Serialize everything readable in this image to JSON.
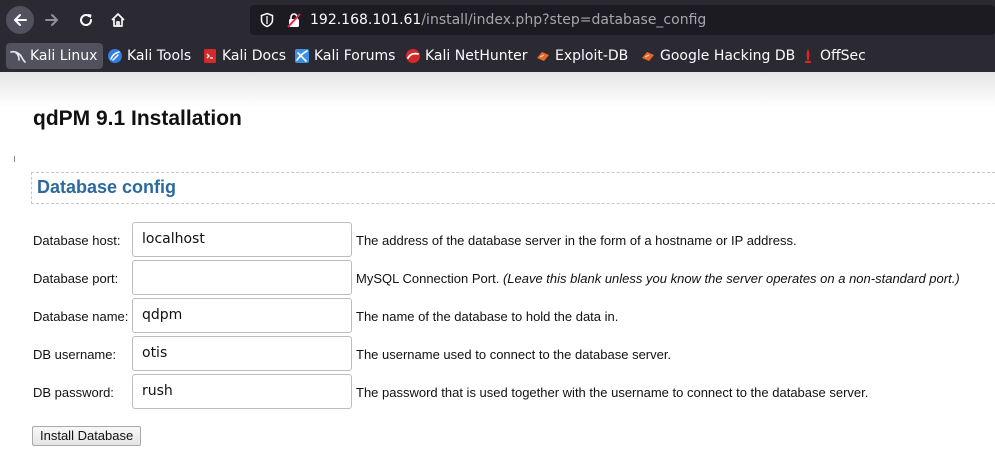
{
  "browser": {
    "url_host": "192.168.101.61",
    "url_path": "/install/index.php?step=database_config",
    "bookmarks": [
      {
        "label": "Kali Linux",
        "icon": "kali-dragon-icon"
      },
      {
        "label": "Kali Tools",
        "icon": "kali-tools-icon"
      },
      {
        "label": "Kali Docs",
        "icon": "kali-docs-icon"
      },
      {
        "label": "Kali Forums",
        "icon": "kali-forums-icon"
      },
      {
        "label": "Kali NetHunter",
        "icon": "nethunter-icon"
      },
      {
        "label": "Exploit-DB",
        "icon": "exploit-db-icon"
      },
      {
        "label": "Google Hacking DB",
        "icon": "ghdb-icon"
      },
      {
        "label": "OffSec",
        "icon": "offsec-icon"
      }
    ]
  },
  "page": {
    "title": "qdPM 9.1 Installation",
    "section_heading": "Database config",
    "fields": [
      {
        "label": "Database host:",
        "value": "localhost",
        "help": "The address of the database server in the form of a hostname or IP address.",
        "help_note": ""
      },
      {
        "label": "Database port:",
        "value": "",
        "help": "MySQL Connection Port.",
        "help_note": "(Leave this blank unless you know the server operates on a non-standard port.)"
      },
      {
        "label": "Database name:",
        "value": "qdpm",
        "help": "The name of the database to hold the data in.",
        "help_note": ""
      },
      {
        "label": "DB username:",
        "value": "otis",
        "help": "The username used to connect to the database server.",
        "help_note": ""
      },
      {
        "label": "DB password:",
        "value": "rush",
        "help": "The password that is used together with the username to connect to the database server.",
        "help_note": ""
      }
    ],
    "install_button": "Install Database"
  },
  "colors": {
    "chrome_bg": "#2b2a33",
    "urlbar_bg": "#1c1b22",
    "heading_blue": "#2c6a9d",
    "exploit_orange": "#e8672a",
    "offsec_red": "#d6262a"
  }
}
